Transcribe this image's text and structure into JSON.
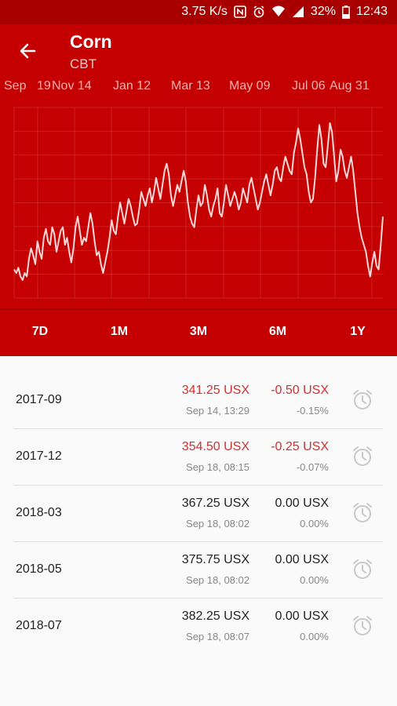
{
  "status": {
    "speed": "3.75 K/s",
    "battery": "32%",
    "time": "12:43"
  },
  "header": {
    "title": "Corn",
    "subtitle": "CBT"
  },
  "chart_dates": [
    "Sep",
    "19",
    "Nov 14",
    "Jan 12",
    "Mar 13",
    "May 09",
    "Jul 06",
    "Aug 31"
  ],
  "ranges": [
    "7D",
    "1M",
    "3M",
    "6M",
    "1Y"
  ],
  "chart_data": {
    "type": "line",
    "x_labels": [
      "Sep 19",
      "Nov 14",
      "Jan 12",
      "Mar 13",
      "May 09",
      "Jul 06",
      "Aug 31"
    ],
    "series": [
      {
        "values": [
          322,
          320,
          323,
          318,
          316,
          320,
          318,
          328,
          334,
          330,
          325,
          338,
          332,
          328,
          340,
          345,
          338,
          336,
          346,
          342,
          332,
          338,
          344,
          346,
          336,
          340,
          332,
          326,
          334,
          346,
          352,
          344,
          336,
          340,
          338,
          346,
          354,
          348,
          338,
          330,
          332,
          325,
          320,
          326,
          332,
          340,
          350,
          344,
          342,
          352,
          360,
          354,
          348,
          355,
          362,
          358,
          352,
          347,
          348,
          356,
          366,
          362,
          358,
          364,
          368,
          360,
          366,
          374,
          368,
          362,
          370,
          378,
          382,
          376,
          364,
          358,
          364,
          370,
          366,
          372,
          378,
          372,
          360,
          352,
          348,
          346,
          356,
          364,
          358,
          360,
          370,
          364,
          356,
          352,
          358,
          362,
          368,
          354,
          352,
          360,
          370,
          364,
          358,
          362,
          366,
          362,
          356,
          360,
          368,
          364,
          360,
          370,
          374,
          368,
          362,
          356,
          360,
          366,
          372,
          376,
          370,
          364,
          370,
          378,
          380,
          374,
          372,
          380,
          386,
          382,
          378,
          376,
          388,
          394,
          402,
          396,
          388,
          380,
          376,
          366,
          360,
          362,
          374,
          390,
          404,
          396,
          382,
          380,
          392,
          405,
          400,
          386,
          372,
          378,
          390,
          386,
          378,
          374,
          380,
          386,
          378,
          366,
          354,
          346,
          340,
          336,
          332,
          324,
          318,
          326,
          332,
          324,
          322,
          336,
          352
        ]
      }
    ]
  },
  "contracts": [
    {
      "month": "2017-09",
      "price": "341.25 USX",
      "price_time": "Sep 14, 13:29",
      "change": "-0.50 USX",
      "pct": "-0.15%",
      "color": "red"
    },
    {
      "month": "2017-12",
      "price": "354.50 USX",
      "price_time": "Sep 18, 08:15",
      "change": "-0.25 USX",
      "pct": "-0.07%",
      "color": "red"
    },
    {
      "month": "2018-03",
      "price": "367.25 USX",
      "price_time": "Sep 18, 08:02",
      "change": "0.00 USX",
      "pct": "0.00%",
      "color": "dark"
    },
    {
      "month": "2018-05",
      "price": "375.75 USX",
      "price_time": "Sep 18, 08:02",
      "change": "0.00 USX",
      "pct": "0.00%",
      "color": "dark"
    },
    {
      "month": "2018-07",
      "price": "382.25 USX",
      "price_time": "Sep 18, 08:07",
      "change": "0.00 USX",
      "pct": "0.00%",
      "color": "dark"
    }
  ]
}
